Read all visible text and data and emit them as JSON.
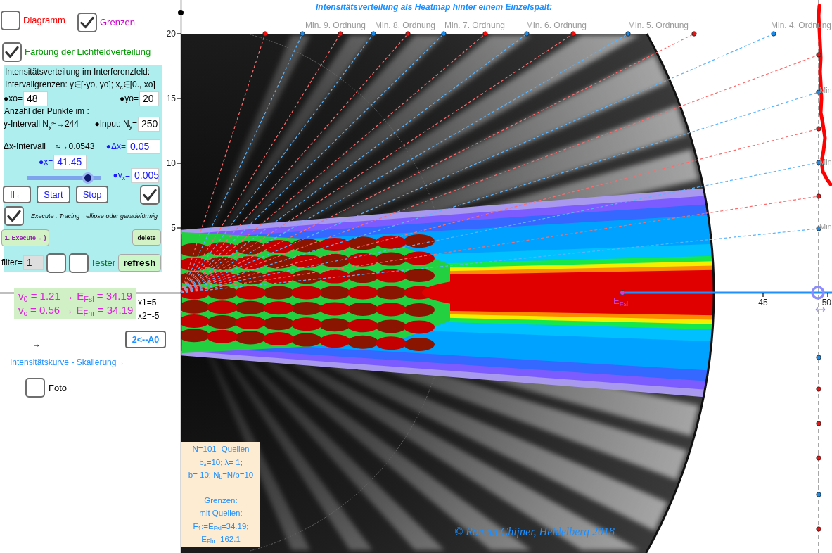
{
  "top_checkboxes": [
    {
      "label": "Diagramm",
      "checked": false,
      "color": "#ff0000"
    },
    {
      "label": "Grenzen",
      "checked": true,
      "color": "#cc00cc"
    },
    {
      "label": "Färbung der Lichtfeldverteilung",
      "checked": true,
      "color": "#009900"
    }
  ],
  "panel": {
    "heading": "Intensitätsverteilung im Interferenzfeld:",
    "interval_text": "Intervallgrenzen: y∈[-yo, yo]; x$_{c}$∈[0., xo]",
    "xo_field": {
      "label": "●xo=",
      "value": "48"
    },
    "yo_field": {
      "label": "●yo=",
      "value": "20"
    },
    "points_text": "Anzahl der Punkte im :",
    "ny_estimate": "y-Intervall N$_{y}$≈→244",
    "ny_field": {
      "label": "●Input: N$_{y}$=",
      "value": "250"
    },
    "dx_label": "Δx-Intervall",
    "dx_estimate": "≈→0.0543",
    "dx_field": {
      "label": "●Δx=",
      "value": "0.05"
    },
    "x_field": {
      "label": "●x=",
      "value": "41.45"
    },
    "x_slider": {
      "level": 0.83
    },
    "vx_field": {
      "label": "●v$_{x}$=",
      "value": "0.005"
    },
    "buttons": [
      "II←",
      "Start",
      "Stop"
    ],
    "trace_checkbox": {
      "checked": true
    },
    "execute_checkbox": {
      "label": "Execute : Tracing→ellipse oder geradeförmig",
      "checked": true
    },
    "execute_button": "1. Execute→ )",
    "delete_button": "delete",
    "filter_field": {
      "label": "filter=",
      "value": "1",
      "disabled": true
    },
    "tester_checkboxes": [
      {
        "checked": false
      },
      {
        "checked": false
      }
    ],
    "tester_label": "Tester",
    "refresh_button": "refresh"
  },
  "results": {
    "lines": [
      "v$_{0}$ = 1.21 → E$_{Fsl}$ = 34.19",
      "v$_{c}$ = 0.56 → E$_{Fhr}$ = 34.19"
    ],
    "x_values": [
      "x1=5",
      "x2=-5"
    ]
  },
  "a0_button": "2<--A0",
  "arrow": "→",
  "scale_caption": "Intensitätskurve - Skalierung→",
  "foto_checkbox": {
    "label": "Foto",
    "checked": false
  },
  "plot": {
    "title": "Intensitätsverteilung als Heatmap hinter einem Einzelspalt:",
    "y_ticks": [
      "20",
      "15",
      "10",
      "5"
    ],
    "x_ticks": [
      "45",
      "50"
    ],
    "order_labels": [
      "Min. 9. Ordnung",
      "Min. 8. Ordnung",
      "Min. 7. Ordnung",
      "Min. 6. Ordnung",
      "Min. 5. Ordnung",
      "Min. 4. Ordnung"
    ],
    "edge_labels": [
      "Min",
      "Min",
      "Min"
    ],
    "point_label": "E$_{Fsl}$"
  },
  "info_box": {
    "paragraphs": [
      [
        "N=101 -Quellen",
        "b$_{λ}$=10;  λ= 1;",
        "b= 10; N$_{b}$=N/b=10"
      ],
      [
        "Grenzen:",
        "mit Quellen:",
        "F$_{1}$:=E$_{Fsl}$=34.19;",
        "E$_{Fhr}$=162.1"
      ]
    ]
  },
  "copyright": "© Roman Chijner, Heidelberg 2018"
}
